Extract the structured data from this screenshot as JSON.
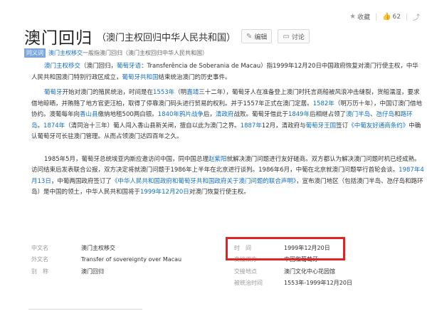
{
  "actions": {
    "favorite_label": "收藏",
    "like_count": "62"
  },
  "header": {
    "title": "澳门回归",
    "subtitle": "（澳门主权回归中华人民共和国）",
    "edit_label": "编辑",
    "discuss_label": "讨论"
  },
  "synonym": {
    "tag": "同义词",
    "link": "澳门主权移交",
    "text": "一般指澳门回归（澳门主权回归中华人民共和国）"
  },
  "paragraphs": [
    {
      "segments": [
        {
          "t": "澳门主权移交",
          "link": true
        },
        {
          "t": "（澳门回归，"
        },
        {
          "t": "葡萄牙语",
          "link": true
        },
        {
          "t": "：Transferência de Soberania de Macau）指1999年12月20日中国政府恢复对澳门行使主权，中华人民共和国澳门特别行政区成立，"
        },
        {
          "t": "葡萄牙共和国",
          "link": true
        },
        {
          "t": "结束统治澳门的历史事件。"
        }
      ]
    },
    {
      "segments": [
        {
          "t": "葡萄牙",
          "link": true
        },
        {
          "t": "开始对澳门的殖民统治，时间是在"
        },
        {
          "t": "1553年",
          "link": true
        },
        {
          "t": "（明"
        },
        {
          "t": "嘉靖",
          "link": true
        },
        {
          "t": "三十二年），葡萄牙人在准备登上澳门时托言商船被风浪冲击缝裂，货船濡湿，要求借地晾晒，并贿赂了地方官吏汪柏，取得了停靠澳门码头进行贸易的权利。并于1557年正式在澳门定居。"
        },
        {
          "t": "1582年",
          "link": true
        },
        {
          "t": "（明万历十年），中国订澳门借地协约。澳葡每年向"
        },
        {
          "t": "香山县",
          "link": true
        },
        {
          "t": "缴纳地租500两白银。"
        },
        {
          "t": "1840年鸦片战争",
          "link": true
        },
        {
          "t": "后，"
        },
        {
          "t": "清政府",
          "link": true
        },
        {
          "t": "战败。葡萄牙借此于"
        },
        {
          "t": "1849年",
          "link": true
        },
        {
          "t": "后相继占领了"
        },
        {
          "t": "澳门半岛",
          "link": true
        },
        {
          "t": "、"
        },
        {
          "t": "氹仔岛",
          "link": true
        },
        {
          "t": "和"
        },
        {
          "t": "路环岛",
          "link": true
        },
        {
          "t": "。"
        },
        {
          "t": "1874年",
          "link": true
        },
        {
          "t": "（清同治十三年）葡人闯入香山县新关闸，擅自以此为澳门之界。"
        },
        {
          "t": "1887年",
          "link": true
        },
        {
          "t": "12月，清政府与"
        },
        {
          "t": "葡萄牙王国",
          "link": true
        },
        {
          "t": "签订"
        },
        {
          "t": "《中葡友好通商条约》",
          "link": true
        },
        {
          "t": "中确认葡萄牙可长驻澳门管理。从而占领澳门达四百年之久。"
        }
      ]
    },
    {
      "gap": true,
      "segments": [
        {
          "t": "1985年5月，葡萄牙总统埃亚内斯应邀访问中国，同中国总理"
        },
        {
          "t": "赵紫阳",
          "link": true
        },
        {
          "t": "就解决澳门问题进行友好磋商。双方都认为解决澳门问题时机已经成熟。访问结束后发表联合公报，双方决定将就澳门问题于1986年上半年在北京进行谈判。1986年6月，中葡在北京就澳门问题举行首轮会谈。"
        },
        {
          "t": "1987年4月13日",
          "link": true
        },
        {
          "t": "，中葡两国政府签订了"
        },
        {
          "t": "《中华人民共和国政府和葡萄牙共和国政府关于澳门问题的联合声明》",
          "link": true
        },
        {
          "t": "，宣布澳门地区（包括澳门半岛、氹仔岛和路环岛）是中国的领土，中华人民共和国将于"
        },
        {
          "t": "1999年12月20日",
          "link": true
        },
        {
          "t": "对澳门恢复行使主权。"
        }
      ]
    }
  ],
  "info": {
    "left": [
      {
        "key": "中文名",
        "value": "澳门主权移交"
      },
      {
        "key": "外文名",
        "value": "Transfer of sovereignty over Macau"
      },
      {
        "key": "别　称",
        "value": "澳门回归"
      }
    ],
    "right": [
      {
        "key": "时　间",
        "value": "1999年12月20日"
      },
      {
        "key": "交接双方",
        "value": "中国和葡萄牙"
      },
      {
        "key": "交接地点",
        "value": "澳门文化中心花园馆"
      },
      {
        "key": "被统治时间",
        "value": "1553年-1999年12月20日"
      }
    ]
  }
}
